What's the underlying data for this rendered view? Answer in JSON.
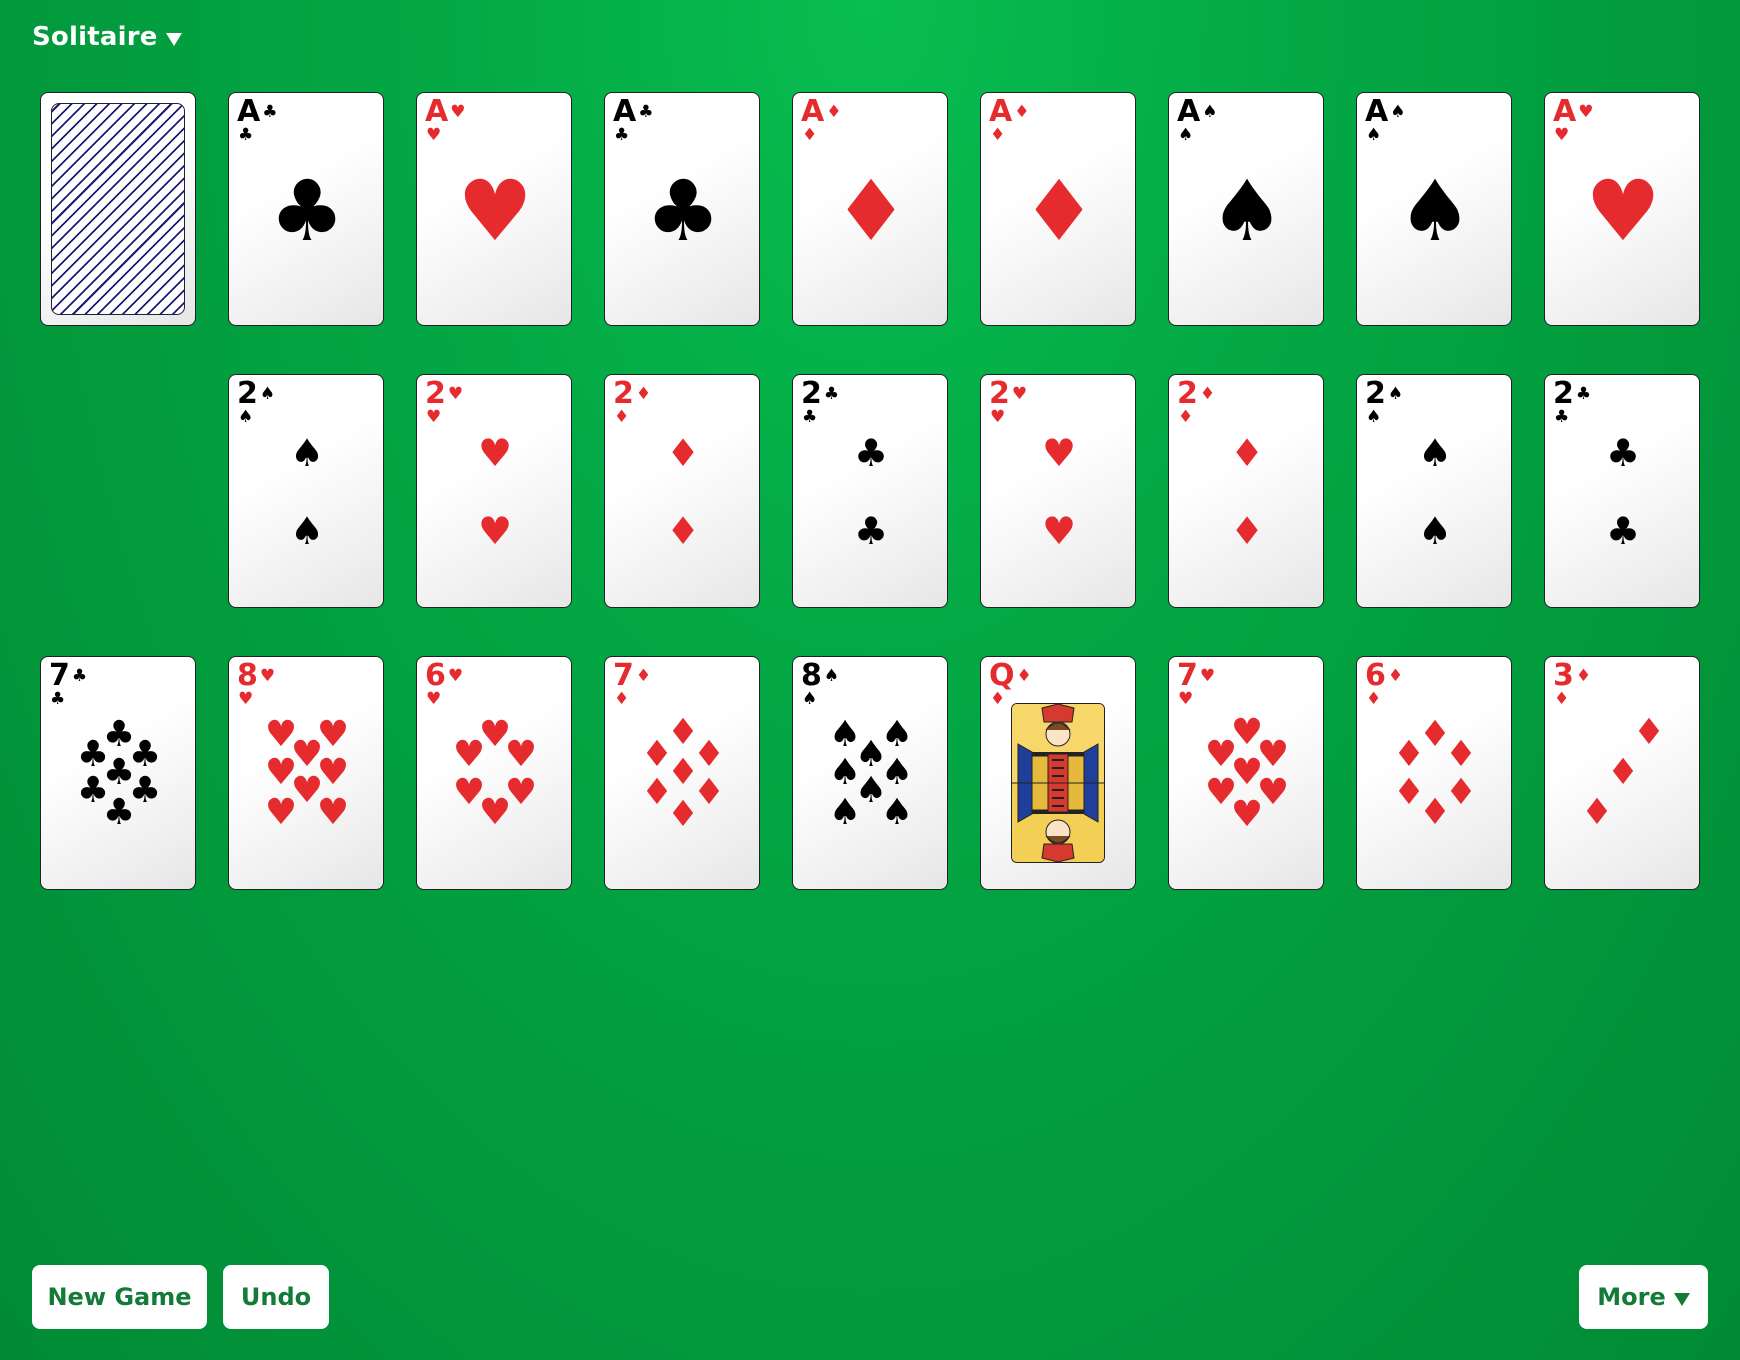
{
  "app": {
    "title": "Solitaire",
    "menu_icon": "caret-down-icon"
  },
  "colors": {
    "felt": "#03a845",
    "red_suit": "#e52b2e",
    "black_suit": "#000000",
    "button_text": "#137a37",
    "card_back_stripe": "#1b1b7a"
  },
  "symbols": {
    "spades": "♠",
    "hearts": "♥",
    "diamonds": "♦",
    "clubs": "♣"
  },
  "stock": {
    "face_down": true,
    "icon": "card-back-pattern"
  },
  "rows": [
    [
      {
        "rank": "A",
        "suit": "clubs"
      },
      {
        "rank": "A",
        "suit": "hearts"
      },
      {
        "rank": "A",
        "suit": "clubs"
      },
      {
        "rank": "A",
        "suit": "diamonds"
      },
      {
        "rank": "A",
        "suit": "diamonds"
      },
      {
        "rank": "A",
        "suit": "spades"
      },
      {
        "rank": "A",
        "suit": "spades"
      },
      {
        "rank": "A",
        "suit": "hearts"
      }
    ],
    [
      {
        "rank": "2",
        "suit": "spades"
      },
      {
        "rank": "2",
        "suit": "hearts"
      },
      {
        "rank": "2",
        "suit": "diamonds"
      },
      {
        "rank": "2",
        "suit": "clubs"
      },
      {
        "rank": "2",
        "suit": "hearts"
      },
      {
        "rank": "2",
        "suit": "diamonds"
      },
      {
        "rank": "2",
        "suit": "spades"
      },
      {
        "rank": "2",
        "suit": "clubs"
      }
    ],
    [
      {
        "rank": "7",
        "suit": "clubs"
      },
      {
        "rank": "8",
        "suit": "hearts"
      },
      {
        "rank": "6",
        "suit": "hearts"
      },
      {
        "rank": "7",
        "suit": "diamonds"
      },
      {
        "rank": "8",
        "suit": "spades"
      },
      {
        "rank": "Q",
        "suit": "diamonds"
      },
      {
        "rank": "7",
        "suit": "hearts"
      },
      {
        "rank": "6",
        "suit": "diamonds"
      },
      {
        "rank": "3",
        "suit": "diamonds"
      }
    ]
  ],
  "buttons": {
    "new_game": "New Game",
    "undo": "Undo",
    "more": "More",
    "more_icon": "caret-down-icon"
  }
}
